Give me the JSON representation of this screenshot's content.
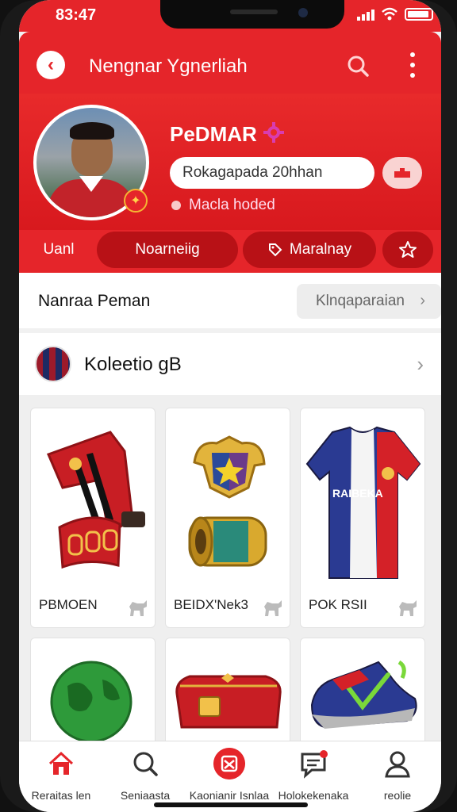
{
  "status_bar": {
    "time": "83:47"
  },
  "header": {
    "title": "Nengnar Ygnerliah"
  },
  "profile": {
    "name": "PeDMAR",
    "input_value": "Rokagapada 20hhan",
    "status_text": "Macla hoded"
  },
  "tabs": [
    {
      "label": "Uanl"
    },
    {
      "label": "Noarneiig"
    },
    {
      "label": "Maralnay"
    }
  ],
  "section_primary": {
    "label": "Nanraa Peman",
    "button_label": "Klnqaparaian"
  },
  "collection": {
    "title": "Koleetio gB"
  },
  "items": [
    {
      "name": "PBMOEN"
    },
    {
      "name": "BEIDX'Nek3"
    },
    {
      "name": "POK RSII"
    },
    {
      "name": ""
    },
    {
      "name": ""
    },
    {
      "name": ""
    }
  ],
  "jersey_text": "RAIBEKA",
  "bottom_nav": [
    {
      "label": "Reraitas len",
      "icon": "home-icon"
    },
    {
      "label": "Seniaasta",
      "icon": "search-icon"
    },
    {
      "label": "Kaonianir Isnlaa",
      "icon": "center-action-icon"
    },
    {
      "label": "Holokekenaka",
      "icon": "chat-icon"
    },
    {
      "label": "reolie",
      "icon": "profile-icon"
    }
  ],
  "colors": {
    "accent": "#e5252a",
    "accent_dark": "#b81116",
    "background": "#f1f1f1"
  }
}
